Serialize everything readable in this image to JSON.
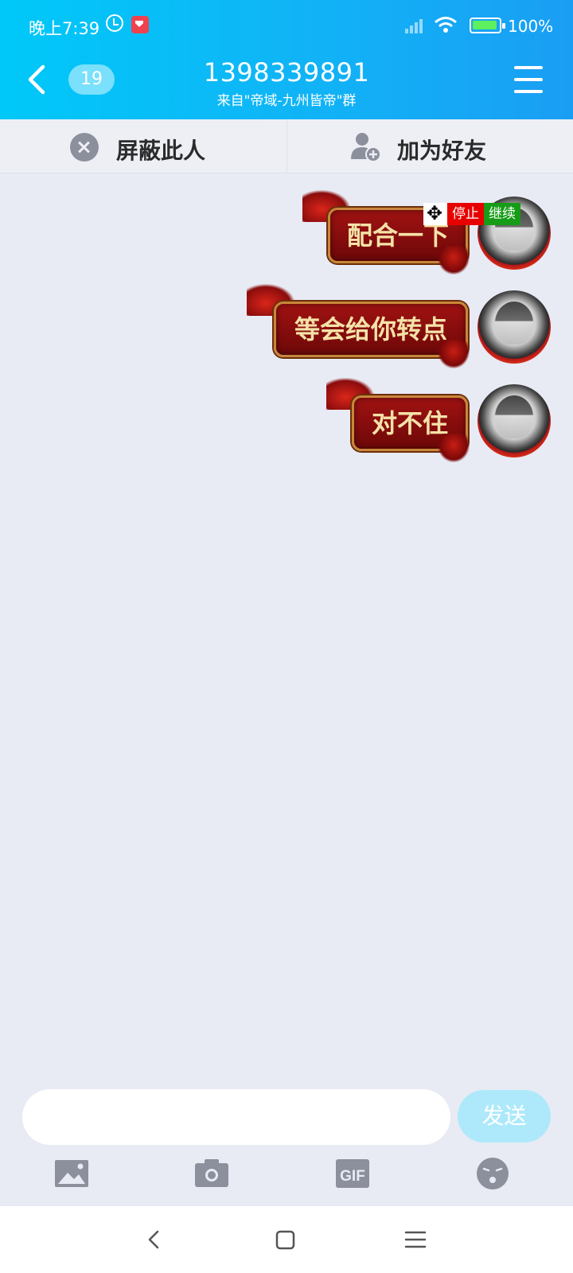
{
  "status_bar": {
    "time": "晚上7:39",
    "battery": "100%"
  },
  "header": {
    "unread_count": "19",
    "title": "1398339891",
    "subtitle": "来自\"帝域-九州皆帝\"群"
  },
  "actions": {
    "block_label": "屏蔽此人",
    "add_friend_label": "加为好友"
  },
  "overlay": {
    "stop_label": "停止",
    "continue_label": "继续"
  },
  "messages": [
    {
      "text": "配合一下"
    },
    {
      "text": "等会给你转点"
    },
    {
      "text": "对不住"
    }
  ],
  "composer": {
    "input_value": "",
    "send_label": "发送"
  },
  "toolbar": {
    "icons": [
      "image-icon",
      "camera-icon",
      "gif-icon",
      "emoji-icon"
    ],
    "gif_label": "GIF"
  },
  "colors": {
    "header_start": "#00c8f8",
    "header_end": "#1a9ef4",
    "chat_bg": "#e8ebf4",
    "bubble": "#8b0e0e",
    "bubble_text": "#f5e2a8",
    "send_button": "#aee9fb"
  }
}
